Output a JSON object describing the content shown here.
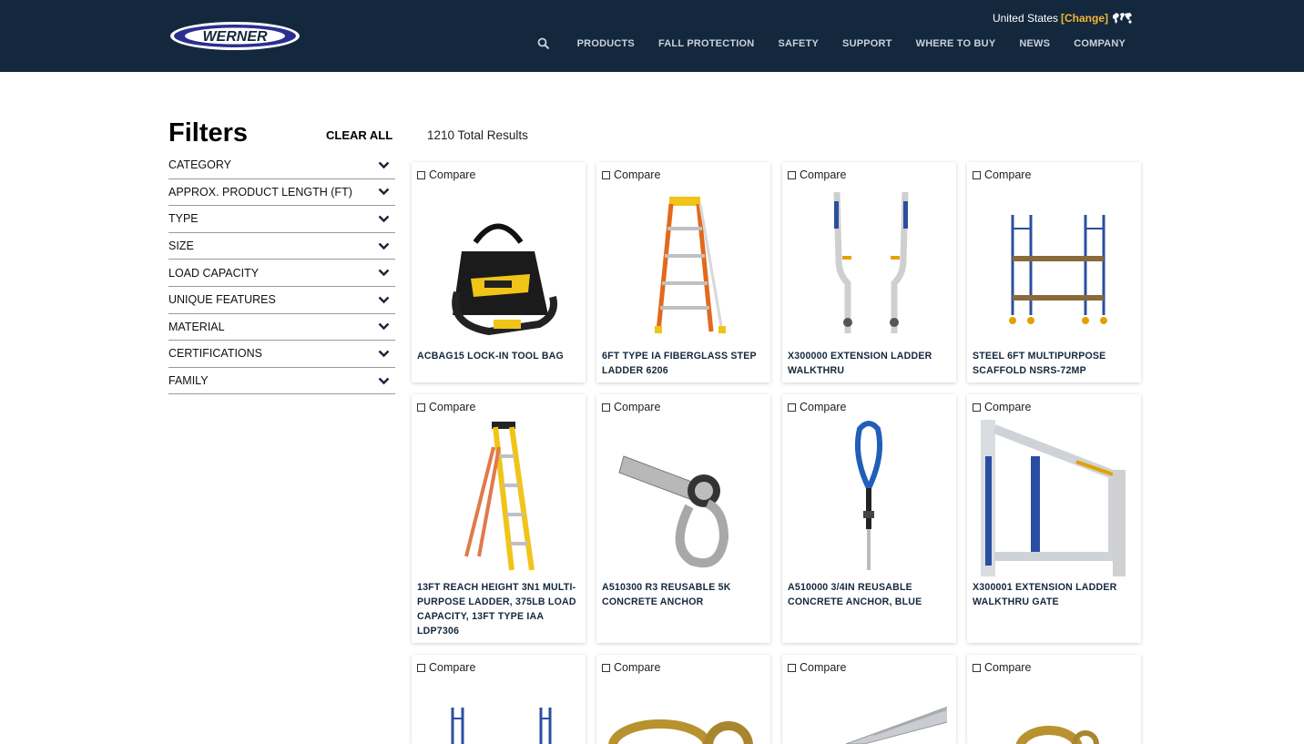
{
  "header": {
    "logo_text": "WERNER",
    "region_label": "United States",
    "region_change": "[Change]",
    "nav": [
      "PRODUCTS",
      "FALL PROTECTION",
      "SAFETY",
      "SUPPORT",
      "WHERE TO BUY",
      "NEWS",
      "COMPANY"
    ],
    "icons": {
      "search": "search-icon",
      "globe": "world-map-icon"
    }
  },
  "filters": {
    "title": "Filters",
    "clear_all": "CLEAR ALL",
    "items": [
      "CATEGORY",
      "APPROX. PRODUCT LENGTH (FT)",
      "TYPE",
      "SIZE",
      "LOAD CAPACITY",
      "UNIQUE FEATURES",
      "MATERIAL",
      "CERTIFICATIONS",
      "FAMILY"
    ]
  },
  "results": {
    "count_text": "1210 Total Results",
    "compare_label": "Compare",
    "products": [
      {
        "name": "ACBAG15 LOCK-IN TOOL BAG",
        "image": "tool-bag-icon"
      },
      {
        "name": "6FT TYPE IA FIBERGLASS STEP LADDER 6206",
        "image": "step-ladder-icon"
      },
      {
        "name": "X300000 EXTENSION LADDER WALKTHRU",
        "image": "ladder-walkthru-icon"
      },
      {
        "name": "STEEL 6FT MULTIPURPOSE SCAFFOLD NSRS-72MP",
        "image": "scaffold-icon"
      },
      {
        "name": "13FT REACH HEIGHT 3N1 MULTI-PURPOSE LADDER, 375LB LOAD CAPACITY, 13FT TYPE IAA LDP7306",
        "image": "multipurpose-ladder-icon"
      },
      {
        "name": "A510300 R3 REUSABLE 5K CONCRETE ANCHOR",
        "image": "concrete-anchor-icon"
      },
      {
        "name": "A510000 3/4IN REUSABLE CONCRETE ANCHOR, BLUE",
        "image": "blue-anchor-icon"
      },
      {
        "name": "X300001 EXTENSION LADDER WALKTHRU GATE",
        "image": "walkthru-gate-icon"
      },
      {
        "name": "",
        "image": "scaffold-frame-icon"
      },
      {
        "name": "",
        "image": "gold-rings-icon"
      },
      {
        "name": "",
        "image": "aluminum-plank-icon"
      },
      {
        "name": "",
        "image": "gold-ring-icon"
      }
    ]
  },
  "colors": {
    "header_bg": "#14283d",
    "accent": "#f2b632",
    "product_name": "#14283d"
  }
}
